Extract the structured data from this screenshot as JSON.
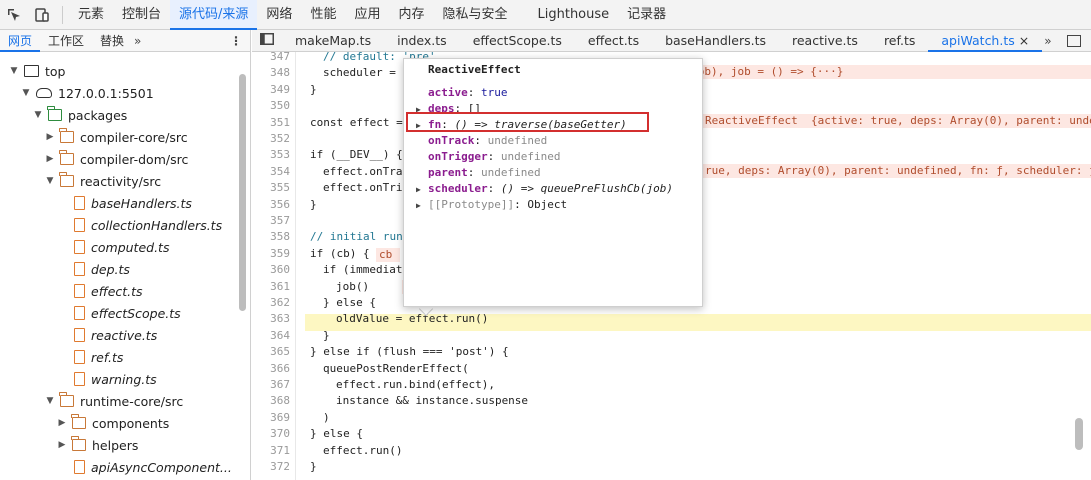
{
  "topbar": {
    "tabs": [
      {
        "label": "元素"
      },
      {
        "label": "控制台"
      },
      {
        "label": "源代码/来源"
      },
      {
        "label": "网络"
      },
      {
        "label": "性能"
      },
      {
        "label": "应用"
      },
      {
        "label": "内存"
      },
      {
        "label": "隐私与安全"
      },
      {
        "label": "Lighthouse"
      },
      {
        "label": "记录器"
      }
    ],
    "active_tab": "源代码/来源"
  },
  "navigator": {
    "tabs": [
      {
        "label": "网页"
      },
      {
        "label": "工作区"
      },
      {
        "label": "替换"
      }
    ],
    "more": "»",
    "tree": [
      {
        "label": "top",
        "kind": "frame",
        "depth": 0,
        "expanded": true
      },
      {
        "label": "127.0.0.1:5501",
        "kind": "cloud",
        "depth": 1,
        "expanded": true
      },
      {
        "label": "packages",
        "kind": "folder-green",
        "depth": 2,
        "expanded": true
      },
      {
        "label": "compiler-core/src",
        "kind": "folder",
        "depth": 3,
        "expanded": false
      },
      {
        "label": "compiler-dom/src",
        "kind": "folder",
        "depth": 3,
        "expanded": false
      },
      {
        "label": "reactivity/src",
        "kind": "folder",
        "depth": 3,
        "expanded": true
      },
      {
        "label": "baseHandlers.ts",
        "kind": "file",
        "depth": 4
      },
      {
        "label": "collectionHandlers.ts",
        "kind": "file",
        "depth": 4
      },
      {
        "label": "computed.ts",
        "kind": "file",
        "depth": 4
      },
      {
        "label": "dep.ts",
        "kind": "file",
        "depth": 4
      },
      {
        "label": "effect.ts",
        "kind": "file",
        "depth": 4
      },
      {
        "label": "effectScope.ts",
        "kind": "file",
        "depth": 4
      },
      {
        "label": "reactive.ts",
        "kind": "file",
        "depth": 4
      },
      {
        "label": "ref.ts",
        "kind": "file",
        "depth": 4
      },
      {
        "label": "warning.ts",
        "kind": "file",
        "depth": 4
      },
      {
        "label": "runtime-core/src",
        "kind": "folder",
        "depth": 3,
        "expanded": true
      },
      {
        "label": "components",
        "kind": "folder",
        "depth": 4,
        "expanded": false
      },
      {
        "label": "helpers",
        "kind": "folder",
        "depth": 4,
        "expanded": false
      },
      {
        "label": "apiAsyncComponent...",
        "kind": "file",
        "depth": 4
      }
    ]
  },
  "editor": {
    "tabs": [
      {
        "label": "makeMap.ts"
      },
      {
        "label": "index.ts"
      },
      {
        "label": "effectScope.ts"
      },
      {
        "label": "effect.ts"
      },
      {
        "label": "baseHandlers.ts"
      },
      {
        "label": "reactive.ts"
      },
      {
        "label": "ref.ts"
      },
      {
        "label": "apiWatch.ts",
        "active": true
      }
    ],
    "more": "»",
    "close_glyph": "×",
    "lines": [
      {
        "n": "347",
        "text": "// default: 'pre'"
      },
      {
        "n": "348",
        "text": "scheduler = () => queuePreFlushCb(job)"
      },
      {
        "n": "349",
        "text": "}"
      },
      {
        "n": "350",
        "text": ""
      },
      {
        "n": "351",
        "text": "const effect = new ReactiveEffect(getter, scheduler)"
      },
      {
        "n": "352",
        "text": ""
      },
      {
        "n": "353",
        "text": "if (__DEV__) {"
      },
      {
        "n": "354",
        "text": "effect.onTrack = onTrack"
      },
      {
        "n": "355",
        "text": "effect.onTrigger = onTrigger"
      },
      {
        "n": "356",
        "text": "}"
      },
      {
        "n": "357",
        "text": ""
      },
      {
        "n": "358",
        "text": "// initial run"
      },
      {
        "n": "359",
        "text": "if (cb) {"
      },
      {
        "n": "360",
        "text": "if (immediate) {"
      },
      {
        "n": "361",
        "text": "job()"
      },
      {
        "n": "362",
        "text": "} else {"
      },
      {
        "n": "363",
        "text": "oldValue = effect.run()"
      },
      {
        "n": "364",
        "text": "}"
      },
      {
        "n": "365",
        "text": "} else if (flush === 'post') {"
      },
      {
        "n": "366",
        "text": "queuePostRenderEffect("
      },
      {
        "n": "367",
        "text": "effect.run.bind(effect),"
      },
      {
        "n": "368",
        "text": "instance && instance.suspense"
      },
      {
        "n": "369",
        "text": ")"
      },
      {
        "n": "370",
        "text": "} else {"
      },
      {
        "n": "371",
        "text": "effect.run()"
      },
      {
        "n": "372",
        "text": "}"
      }
    ],
    "inline_values": {
      "l348": "uePreFlushCb(job), job = () => {···}",
      "l351": "ReactiveEffect  {active: true, deps: Array(0), parent: undefin",
      "l354": "rue, deps: Array(0), parent: undefined, fn: ƒ, scheduler: ƒ,",
      "l359": "cb",
      "l361": "jo"
    }
  },
  "popover": {
    "title": "ReactiveEffect",
    "rows": [
      {
        "key": "active",
        "sep": ": ",
        "value": "true",
        "kind": "value",
        "arrow": ""
      },
      {
        "key": "deps",
        "sep": ": ",
        "value": "[]",
        "kind": "plain",
        "arrow": "▶"
      },
      {
        "key": "fn",
        "sep": ": ",
        "value": "() => traverse(baseGetter)",
        "kind": "func",
        "arrow": "▶"
      },
      {
        "key": "onTrack",
        "sep": ": ",
        "value": "undefined",
        "kind": "undef",
        "arrow": ""
      },
      {
        "key": "onTrigger",
        "sep": ": ",
        "value": "undefined",
        "kind": "undef",
        "arrow": ""
      },
      {
        "key": "parent",
        "sep": ": ",
        "value": "undefined",
        "kind": "undef",
        "arrow": ""
      },
      {
        "key": "scheduler",
        "sep": ": ",
        "value": "() => queuePreFlushCb(job)",
        "kind": "func",
        "arrow": "▶"
      },
      {
        "key": "[[Prototype]]",
        "sep": ": ",
        "value": "Object",
        "kind": "proto",
        "arrow": "▶"
      }
    ]
  }
}
